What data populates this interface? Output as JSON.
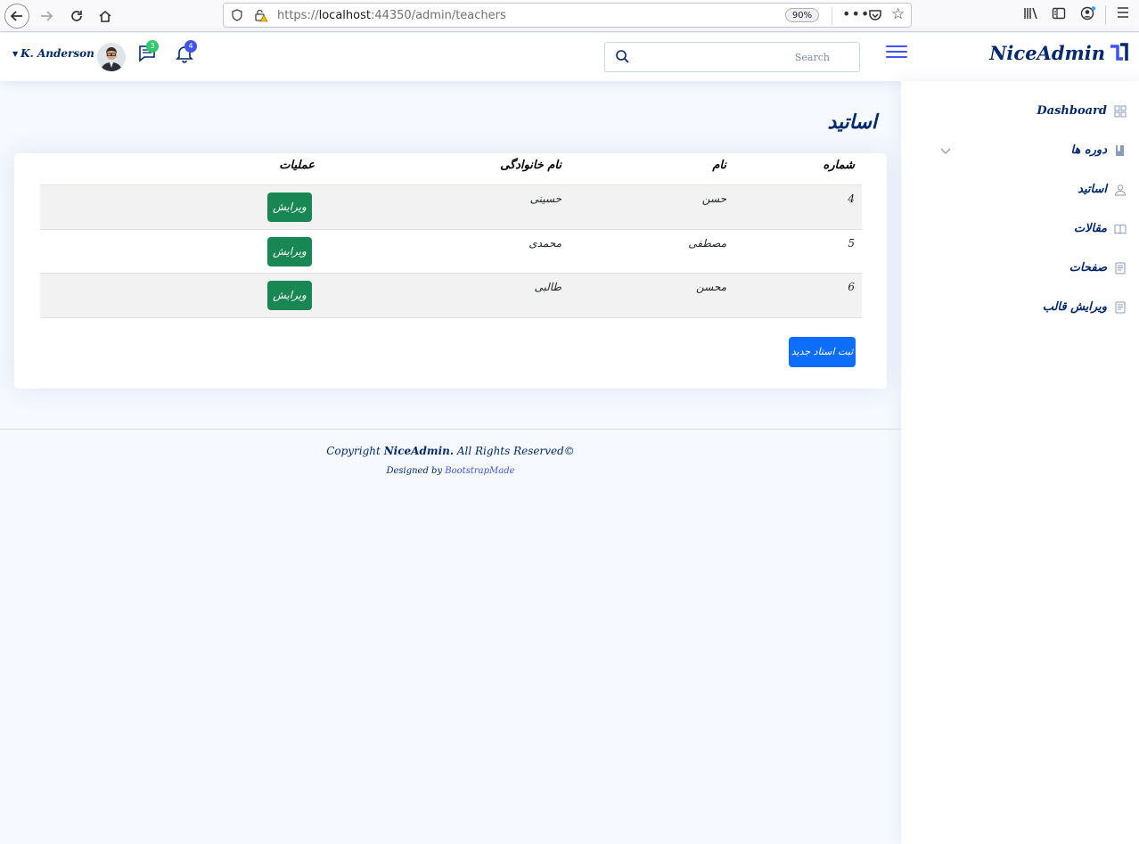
{
  "browser": {
    "url_prefix": "https://",
    "url_host": "localhost",
    "url_rest": ":44350/admin/teachers",
    "zoom": "90%",
    "more_label": "•••"
  },
  "header": {
    "logo_text": "NiceAdmin",
    "search_placeholder": "Search",
    "notifications_count": "4",
    "messages_count": "3",
    "profile_name": "K. Anderson"
  },
  "sidebar": {
    "items": [
      {
        "label": "Dashboard",
        "icon": "grid-icon"
      },
      {
        "label": "دوره ها",
        "icon": "book-icon"
      },
      {
        "label": "اساتید",
        "icon": "person-icon"
      },
      {
        "label": "مقالات",
        "icon": "open-book-icon"
      },
      {
        "label": "صفحات",
        "icon": "document-icon"
      },
      {
        "label": "ویرایش قالب",
        "icon": "document-icon"
      }
    ]
  },
  "page": {
    "title": "اساتید"
  },
  "table": {
    "headers": {
      "number": "شماره",
      "name": "نام",
      "family": "نام خانوادگی",
      "operations": "عملیات"
    },
    "rows": [
      {
        "number": "4",
        "name": "حسن",
        "family": "حسینی",
        "action": "ویرایش"
      },
      {
        "number": "5",
        "name": "مصطفی",
        "family": "محمدی",
        "action": "ویرایش"
      },
      {
        "number": "6",
        "name": "محسن",
        "family": "طالبی",
        "action": "ویرایش"
      }
    ],
    "new_button": "ثبت استاد جدید"
  },
  "footer": {
    "copyright_prefix": "Copyright",
    "brand": "NiceAdmin.",
    "rights": "All Rights Reserved",
    "designed_by": "Designed by",
    "designer": "BootstrapMade"
  },
  "colors": {
    "primary": "#4154f1",
    "navy": "#012970",
    "success": "#198754",
    "button_blue": "#0d6efd",
    "background": "#f6f9ff"
  }
}
